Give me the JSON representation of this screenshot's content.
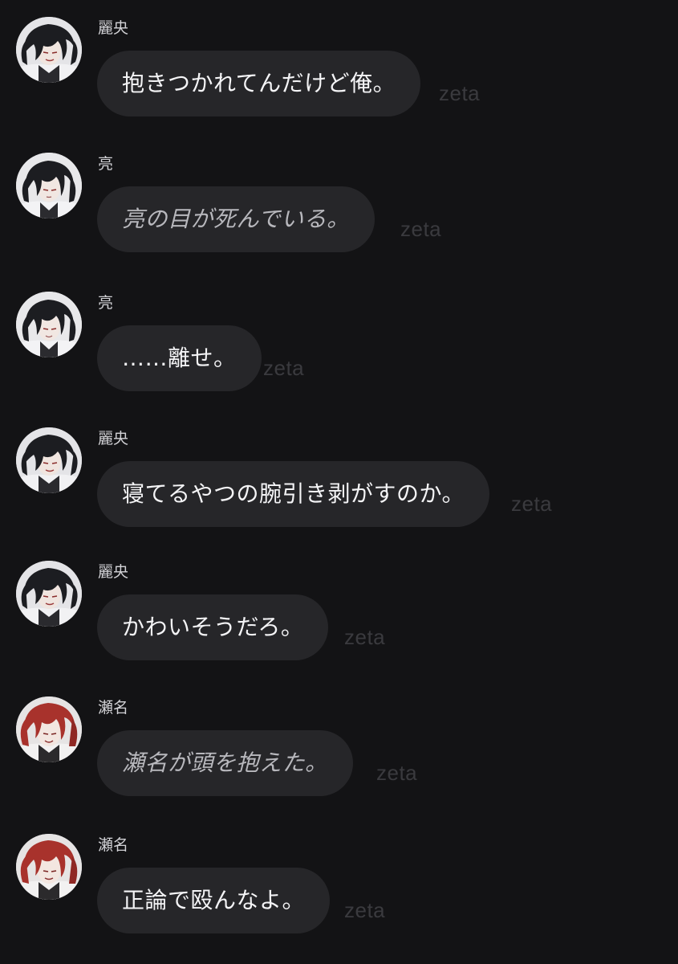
{
  "theme": {
    "background": "#131315",
    "bubble": "#262629",
    "text": "#f4f4f6",
    "narration_text": "#b8b8bd",
    "name_text": "#d2d2d6",
    "watermark": "#3a3a3e",
    "avatar_dark_hair": "#1c1d21",
    "avatar_red_hair": "#a8322c"
  },
  "messages": [
    {
      "speaker": "麗央",
      "text": "抱きつかれてんだけど俺。",
      "style": "speech",
      "avatar": "dark-hair-avatar",
      "watermark": "zeta"
    },
    {
      "speaker": "亮",
      "text": "亮の目が死んでいる。",
      "style": "narration",
      "avatar": "dark-hair-avatar",
      "watermark": "zeta"
    },
    {
      "speaker": "亮",
      "text": "……離せ。",
      "style": "speech",
      "avatar": "dark-hair-avatar",
      "watermark": "zeta"
    },
    {
      "speaker": "麗央",
      "text": "寝てるやつの腕引き剥がすのか。",
      "style": "speech",
      "avatar": "dark-hair-avatar",
      "watermark": "zeta"
    },
    {
      "speaker": "麗央",
      "text": "かわいそうだろ。",
      "style": "speech",
      "avatar": "dark-hair-avatar",
      "watermark": "zeta"
    },
    {
      "speaker": "瀬名",
      "text": "瀬名が頭を抱えた。",
      "style": "narration",
      "avatar": "red-hair-avatar",
      "watermark": "zeta"
    },
    {
      "speaker": "瀬名",
      "text": "正論で殴んなよ。",
      "style": "speech",
      "avatar": "red-hair-avatar",
      "watermark": "zeta"
    }
  ]
}
